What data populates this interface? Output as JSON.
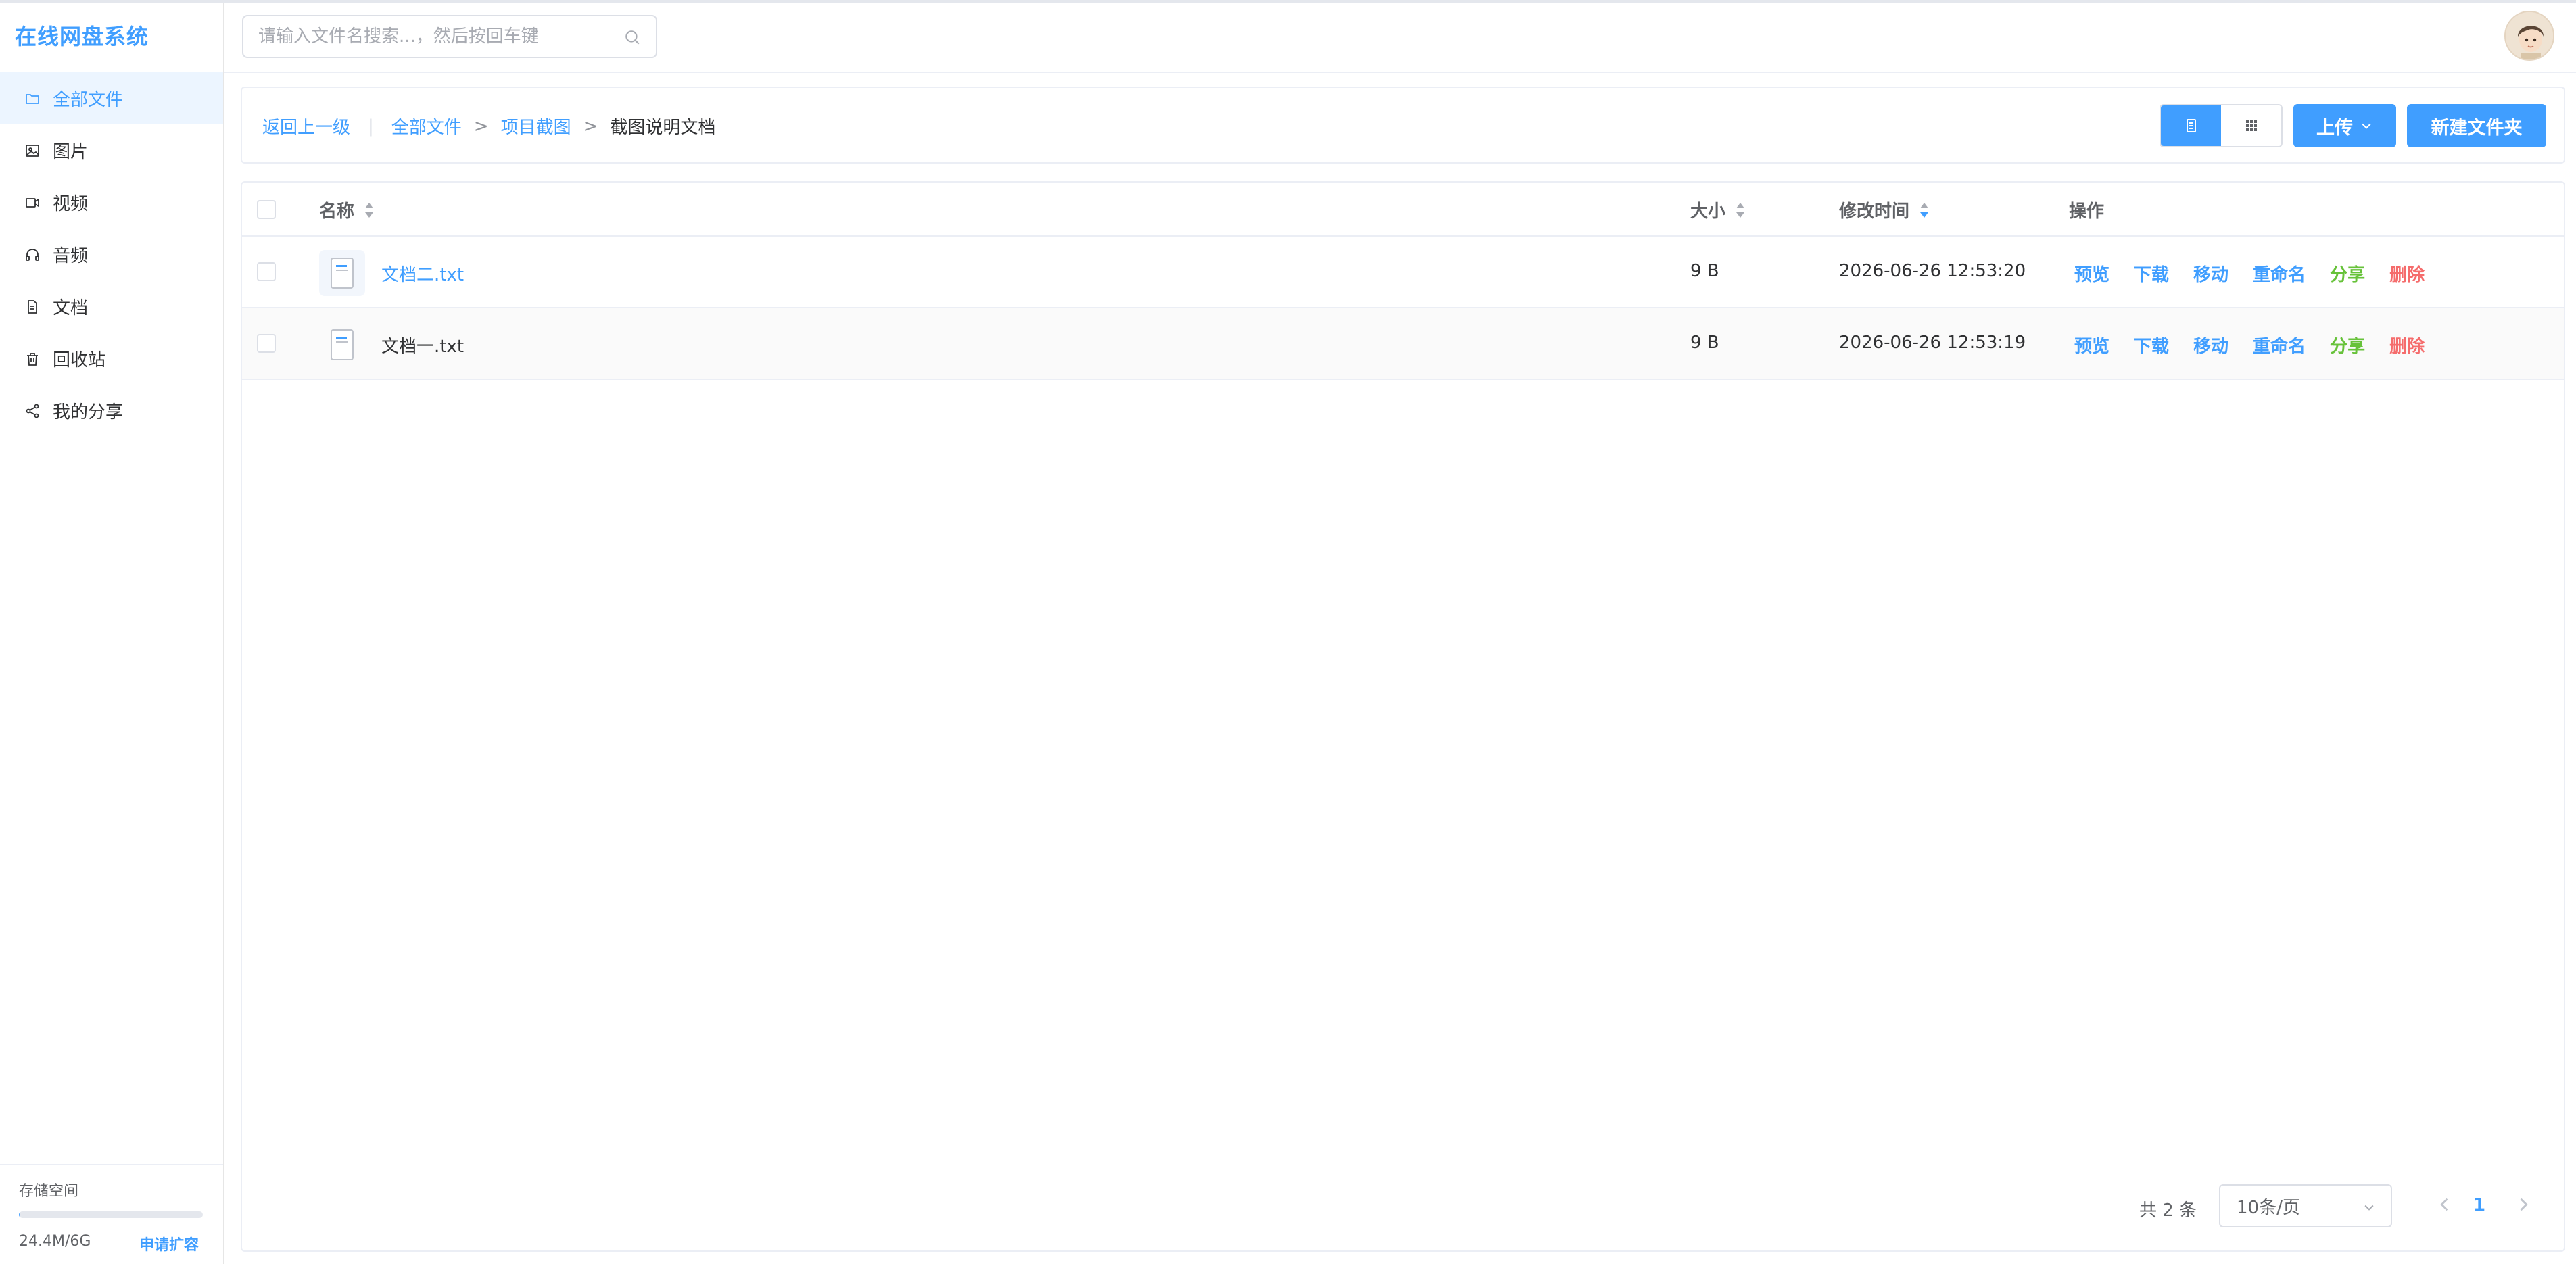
{
  "app": {
    "title": "在线网盘系统"
  },
  "sidebar": {
    "items": [
      {
        "label": "全部文件",
        "icon": "folder-icon",
        "active": true
      },
      {
        "label": "图片",
        "icon": "image-icon"
      },
      {
        "label": "视频",
        "icon": "video-icon"
      },
      {
        "label": "音频",
        "icon": "headphones-icon"
      },
      {
        "label": "文档",
        "icon": "document-icon"
      },
      {
        "label": "回收站",
        "icon": "trash-icon"
      },
      {
        "label": "我的分享",
        "icon": "share-icon"
      }
    ],
    "storage": {
      "title": "存储空间",
      "used": "24.4M/6G",
      "expand_label": "申请扩容",
      "fill_fraction": 0.004
    }
  },
  "header": {
    "search": {
      "placeholder": "请输入文件名搜索...，然后按回车键",
      "value": ""
    },
    "avatar": "avatar-icon"
  },
  "toolbar": {
    "back_label": "返回上一级",
    "breadcrumb": [
      "全部文件",
      "项目截图",
      "截图说明文档"
    ],
    "view_modes": [
      "list-icon",
      "grid-icon"
    ],
    "upload_label": "上传",
    "new_folder_label": "新建文件夹"
  },
  "table": {
    "headers": {
      "name": "名称",
      "size": "大小",
      "modified": "修改时间",
      "ops": "操作"
    },
    "rows": [
      {
        "name": "文档二.txt",
        "size": "9 B",
        "modified": "2026-06-26 12:53:20"
      },
      {
        "name": "文档一.txt",
        "size": "9 B",
        "modified": "2026-06-26 12:53:19"
      }
    ],
    "actions": [
      "预览",
      "下载",
      "移动",
      "重命名",
      "分享",
      "删除"
    ]
  },
  "pagination": {
    "total_label": "共 2 条",
    "page_size": "10条/页",
    "current_page": "1"
  },
  "colors": {
    "accent": "#409eff",
    "success": "#67c23a",
    "danger": "#f56c6c",
    "active_bg": "#ecf5ff"
  }
}
